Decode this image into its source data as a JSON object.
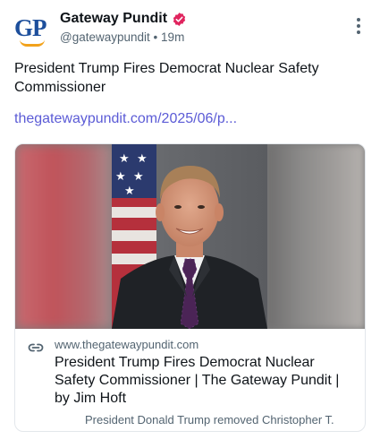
{
  "account": {
    "avatar_text": "GP",
    "display_name": "Gateway Pundit",
    "handle": "@gatewaypundit",
    "separator": "•",
    "time": "19m",
    "verified": true
  },
  "post": {
    "text": "President Trump Fires Democrat Nuclear Safety Commissioner",
    "link": "thegatewaypundit.com/2025/06/p..."
  },
  "card": {
    "domain": "www.thegatewaypundit.com",
    "title": "President Trump Fires Democrat Nuclear Safety Commissioner | The Gateway Pundit | by Jim Hoft",
    "description": "President Donald Trump removed Christopher T."
  },
  "icons": {
    "verified": "verified-badge-icon",
    "menu": "more-vertical-icon",
    "link": "link-icon"
  },
  "colors": {
    "link": "#5b5bd6",
    "verified": "#e0245e",
    "brand_blue": "#1d4f9c",
    "brand_orange": "#f2a21b",
    "secondary_text": "#536471"
  }
}
